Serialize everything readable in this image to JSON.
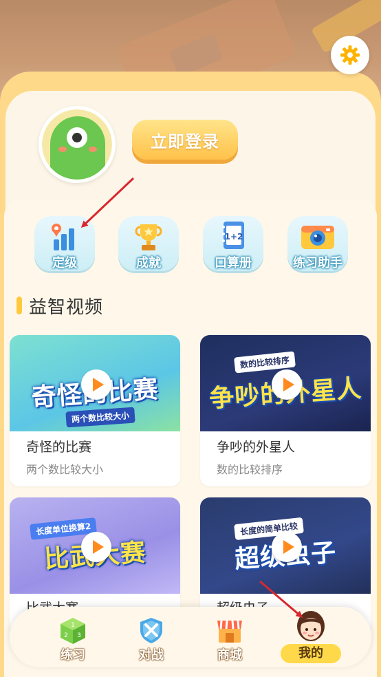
{
  "header": {
    "settings_icon": "gear-icon"
  },
  "profile": {
    "avatar_icon": "green-monster-avatar",
    "login_label": "立即登录"
  },
  "quick_actions": [
    {
      "label": "定级",
      "icon": "bar-chart-pin-icon"
    },
    {
      "label": "成就",
      "icon": "trophy-icon"
    },
    {
      "label": "口算册",
      "icon": "notebook-icon"
    },
    {
      "label": "练习助手",
      "icon": "camera-icon"
    }
  ],
  "section": {
    "title": "益智视频"
  },
  "videos": [
    {
      "title": "奇怪的比赛",
      "subtitle": "两个数比较大小",
      "thumb_title": "奇怪的比赛",
      "thumb_tag": "两个数比较大小"
    },
    {
      "title": "争吵的外星人",
      "subtitle": "数的比较排序",
      "thumb_title": "争吵的外星人",
      "thumb_tag": "数的比较排序"
    },
    {
      "title": "比武大赛",
      "subtitle": "",
      "thumb_title": "比武大赛",
      "thumb_tag": "长度单位换算2"
    },
    {
      "title": "超级虫子",
      "subtitle": "",
      "thumb_title": "超级虫子",
      "thumb_tag": "长度的简单比较"
    }
  ],
  "bottom_nav": [
    {
      "label": "练习",
      "icon": "dice-icon",
      "active": false
    },
    {
      "label": "对战",
      "icon": "shield-swords-icon",
      "active": false
    },
    {
      "label": "商城",
      "icon": "shop-icon",
      "active": false
    },
    {
      "label": "我的",
      "icon": "girl-avatar-icon",
      "active": true
    }
  ],
  "colors": {
    "accent": "#ffc24a",
    "annotation": "#d9272e",
    "panel": "#fdf6e8"
  }
}
